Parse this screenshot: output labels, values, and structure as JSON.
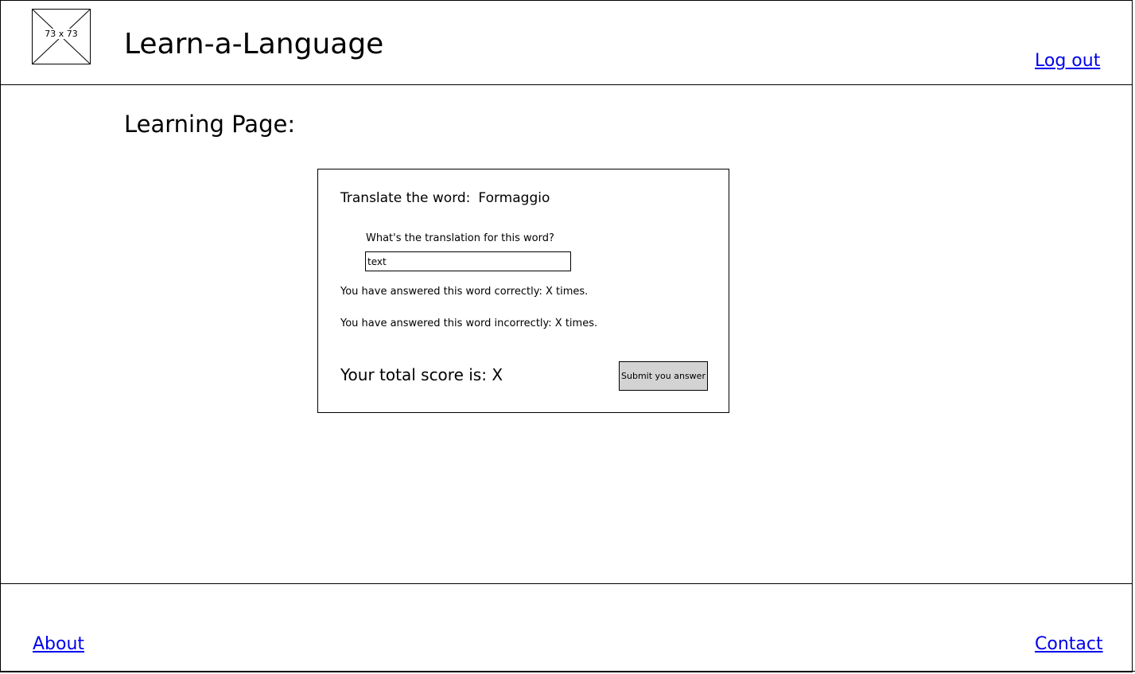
{
  "header": {
    "logo_placeholder": "73 x 73",
    "app_title": "Learn-a-Language",
    "logout_label": "Log out"
  },
  "main": {
    "page_title": "Learning Page:",
    "card": {
      "prompt_label": "Translate the word:",
      "word": "Formaggio",
      "field_label": "What's the translation for this word?",
      "input_value": "text",
      "correct_stat": "You have answered this word correctly: X times.",
      "incorrect_stat": "You have answered this word incorrectly: X times.",
      "score_text": "Your total score is: X",
      "submit_label": "Submit you answer"
    }
  },
  "footer": {
    "about_label": "About",
    "contact_label": "Contact"
  },
  "colors": {
    "link": "#0000ee",
    "button_fill": "#d3d3d3",
    "border": "#000000"
  }
}
